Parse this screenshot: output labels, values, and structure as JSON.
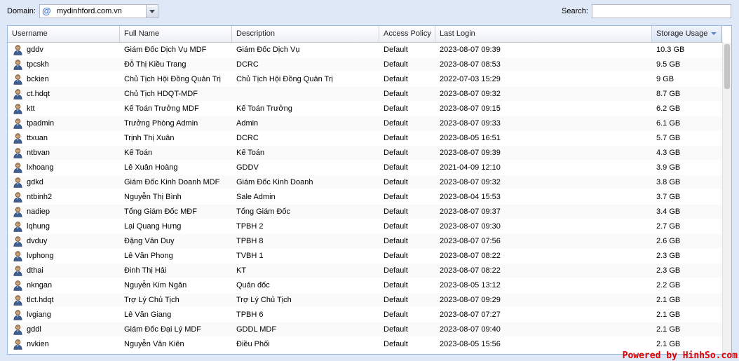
{
  "toolbar": {
    "domain_label": "Domain:",
    "domain_value": "mydinhford.com.vn",
    "search_label": "Search:",
    "search_value": ""
  },
  "columns": [
    "Username",
    "Full Name",
    "Description",
    "Access Policy",
    "Last Login",
    "Storage Usage"
  ],
  "sorted_column": "Storage Usage",
  "rows": [
    {
      "username": "gddv",
      "fullname": "Giám Đốc Dịch Vụ MDF",
      "description": "Giám Đốc Dịch Vụ",
      "policy": "Default",
      "last_login": "2023-08-07 09:39",
      "storage": "10.3 GB"
    },
    {
      "username": "tpcskh",
      "fullname": "Đỗ Thị Kiều Trang",
      "description": "DCRC",
      "policy": "Default",
      "last_login": "2023-08-07 08:53",
      "storage": "9.5 GB"
    },
    {
      "username": "bckien",
      "fullname": "Chủ Tịch Hội Đồng Quản Trị",
      "description": "Chủ Tịch Hội Đồng Quản Trị",
      "policy": "Default",
      "last_login": "2022-07-03 15:29",
      "storage": "9 GB"
    },
    {
      "username": "ct.hdqt",
      "fullname": "Chủ Tịch HDQT-MDF",
      "description": "",
      "policy": "Default",
      "last_login": "2023-08-07 09:32",
      "storage": "8.7 GB"
    },
    {
      "username": "ktt",
      "fullname": "Kế Toán Trưởng MDF",
      "description": "Kế Toán Trưởng",
      "policy": "Default",
      "last_login": "2023-08-07 09:15",
      "storage": "6.2 GB"
    },
    {
      "username": "tpadmin",
      "fullname": "Trưởng Phòng Admin",
      "description": "Admin",
      "policy": "Default",
      "last_login": "2023-08-07 09:33",
      "storage": "6.1 GB"
    },
    {
      "username": "ttxuan",
      "fullname": "Trịnh Thị Xuân",
      "description": "DCRC",
      "policy": "Default",
      "last_login": "2023-08-05 16:51",
      "storage": "5.7 GB"
    },
    {
      "username": "ntbvan",
      "fullname": "Kế Toán",
      "description": "Kế Toán",
      "policy": "Default",
      "last_login": "2023-08-07 09:39",
      "storage": "4.3 GB"
    },
    {
      "username": "lxhoang",
      "fullname": "Lê Xuân Hoàng",
      "description": "GDDV",
      "policy": "Default",
      "last_login": "2021-04-09 12:10",
      "storage": "3.9 GB"
    },
    {
      "username": "gdkd",
      "fullname": "Giám Đốc Kinh Doanh MDF",
      "description": "Giám Đốc Kinh Doanh",
      "policy": "Default",
      "last_login": "2023-08-07 09:32",
      "storage": "3.8 GB"
    },
    {
      "username": "ntbinh2",
      "fullname": "Nguyễn Thị Bình",
      "description": "Sale Admin",
      "policy": "Default",
      "last_login": "2023-08-04 15:53",
      "storage": "3.7 GB"
    },
    {
      "username": "nadiep",
      "fullname": "Tổng Giám Đốc MĐF",
      "description": "Tổng Giám Đốc",
      "policy": "Default",
      "last_login": "2023-08-07 09:37",
      "storage": "3.4 GB"
    },
    {
      "username": "lqhung",
      "fullname": "Lại Quang Hưng",
      "description": "TPBH 2",
      "policy": "Default",
      "last_login": "2023-08-07 09:30",
      "storage": "2.7 GB"
    },
    {
      "username": "dvduy",
      "fullname": "Đặng Văn Duy",
      "description": "TPBH 8",
      "policy": "Default",
      "last_login": "2023-08-07 07:56",
      "storage": "2.6 GB"
    },
    {
      "username": "lvphong",
      "fullname": "Lê Văn Phong",
      "description": "TVBH 1",
      "policy": "Default",
      "last_login": "2023-08-07 08:22",
      "storage": "2.3 GB"
    },
    {
      "username": "dthai",
      "fullname": "Đinh Thị Hải",
      "description": "KT",
      "policy": "Default",
      "last_login": "2023-08-07 08:22",
      "storage": "2.3 GB"
    },
    {
      "username": "nkngan",
      "fullname": "Nguyễn Kim Ngân",
      "description": "Quản đốc",
      "policy": "Default",
      "last_login": "2023-08-05 13:12",
      "storage": "2.2 GB"
    },
    {
      "username": "tlct.hdqt",
      "fullname": "Trợ Lý Chủ Tịch",
      "description": "Trợ Lý Chủ Tịch",
      "policy": "Default",
      "last_login": "2023-08-07 09:29",
      "storage": "2.1 GB"
    },
    {
      "username": "lvgiang",
      "fullname": "Lê Văn Giang",
      "description": "TPBH 6",
      "policy": "Default",
      "last_login": "2023-08-07 07:27",
      "storage": "2.1 GB"
    },
    {
      "username": "gddl",
      "fullname": "Giám Đốc Đại Lý MDF",
      "description": "GDDL MDF",
      "policy": "Default",
      "last_login": "2023-08-07 09:40",
      "storage": "2.1 GB"
    },
    {
      "username": "nvkien",
      "fullname": "Nguyễn Văn Kiên",
      "description": "Điều Phối",
      "policy": "Default",
      "last_login": "2023-08-05 15:56",
      "storage": "2.1 GB"
    }
  ],
  "watermark": "Powered by HinhSo.com"
}
